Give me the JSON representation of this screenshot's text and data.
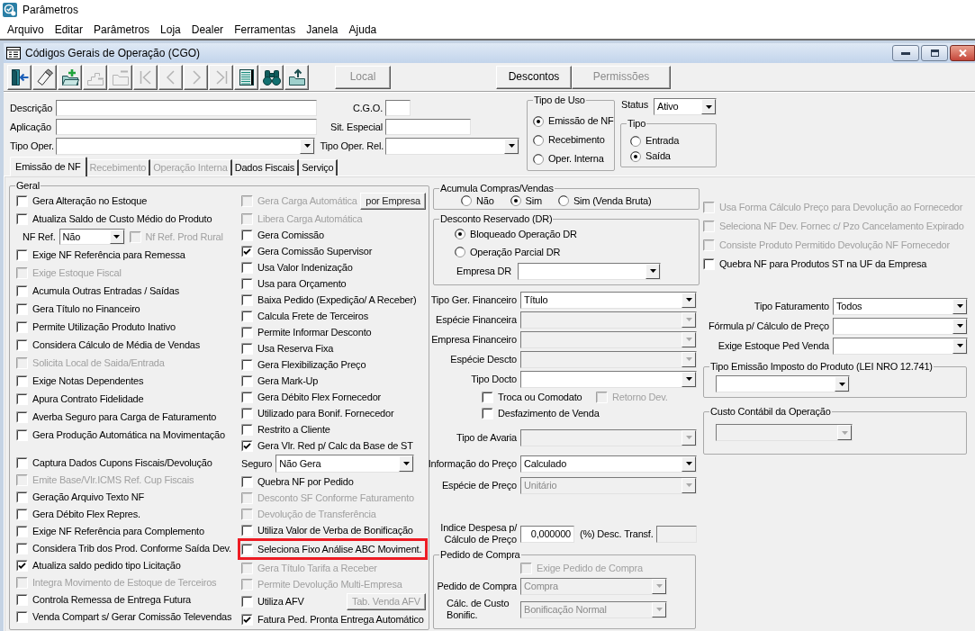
{
  "app": {
    "title": "Parâmetros"
  },
  "menu": [
    "Arquivo",
    "Editar",
    "Parâmetros",
    "Loja",
    "Dealer",
    "Ferramentas",
    "Janela",
    "Ajuda"
  ],
  "window": {
    "title": "Códigos Gerais de Operação (CGO)"
  },
  "toolbar": {
    "icon_buttons": [
      {
        "kind": "exit",
        "disabled": false
      },
      {
        "kind": "erase",
        "disabled": false
      },
      {
        "kind": "add",
        "disabled": false
      },
      {
        "kind": "copy",
        "disabled": true
      },
      {
        "kind": "remove",
        "disabled": true
      },
      {
        "kind": "first",
        "disabled": true
      },
      {
        "kind": "previous",
        "disabled": true
      },
      {
        "kind": "next",
        "disabled": true
      },
      {
        "kind": "last",
        "disabled": true
      },
      {
        "kind": "grid",
        "disabled": false
      },
      {
        "kind": "search",
        "disabled": false
      },
      {
        "kind": "export",
        "disabled": false
      }
    ],
    "text_buttons": [
      {
        "label": "Local",
        "disabled": true
      },
      {
        "label": "Descontos",
        "disabled": false
      },
      {
        "label": "Permissões",
        "disabled": true
      }
    ]
  },
  "header": {
    "description": {
      "label": "Descrição"
    },
    "cgo": {
      "label": "C.G.O."
    },
    "application": {
      "label": "Aplicação"
    },
    "special_situation": {
      "label": "Sit. Especial"
    },
    "operation_type": {
      "label": "Tipo Oper."
    },
    "related_operation_type": {
      "label": "Tipo Oper. Rel."
    },
    "usage_type": {
      "title": "Tipo de Uso",
      "options": [
        {
          "label": "Emissão de NF",
          "selected": true
        },
        {
          "label": "Recebimento",
          "selected": false
        },
        {
          "label": "Oper. Interna",
          "selected": false
        }
      ]
    },
    "status": {
      "label": "Status",
      "value": "Ativo"
    },
    "type": {
      "title": "Tipo",
      "options": [
        {
          "label": "Entrada",
          "selected": false
        },
        {
          "label": "Saída",
          "selected": true
        }
      ]
    }
  },
  "tabs": [
    {
      "label": "Emissão de NF",
      "selected": true,
      "disabled": false
    },
    {
      "label": "Recebimento",
      "selected": false,
      "disabled": true
    },
    {
      "label": "Operação Interna",
      "selected": false,
      "disabled": true
    },
    {
      "label": "Dados Fiscais",
      "selected": false,
      "disabled": false
    },
    {
      "label": "Serviço",
      "selected": false,
      "disabled": false
    }
  ],
  "general": {
    "title": "Geral",
    "column_1": [
      {
        "kind": "checkbox",
        "label": "Gera Alteração no Estoque",
        "checked": false,
        "disabled": false
      },
      {
        "kind": "checkbox",
        "label": "Atualiza Saldo de Custo Médio do Produto",
        "checked": false,
        "disabled": false
      },
      {
        "kind": "reference",
        "label": "NF Ref.",
        "value": "Não",
        "option": {
          "label": "Nf Ref. Prod Rural",
          "checked": false,
          "disabled": true
        }
      },
      {
        "kind": "checkbox",
        "label": "Exige NF Referência para Remessa",
        "checked": false,
        "disabled": false
      },
      {
        "kind": "checkbox",
        "label": "Exige Estoque Fiscal",
        "checked": false,
        "disabled": true
      },
      {
        "kind": "checkbox",
        "label": "Acumula Outras Entradas / Saídas",
        "checked": false,
        "disabled": false
      },
      {
        "kind": "checkbox",
        "label": "Gera Título no Financeiro",
        "checked": false,
        "disabled": false
      },
      {
        "kind": "checkbox",
        "label": "Permite Utilização Produto Inativo",
        "checked": false,
        "disabled": false
      },
      {
        "kind": "checkbox",
        "label": "Considera Cálculo de Média de Vendas",
        "checked": false,
        "disabled": false
      },
      {
        "kind": "checkbox",
        "label": "Solicita Local de Saida/Entrada",
        "checked": false,
        "disabled": true
      },
      {
        "kind": "checkbox",
        "label": "Exige Notas Dependentes",
        "checked": false,
        "disabled": false
      },
      {
        "kind": "checkbox",
        "label": "Apura Contrato Fidelidade",
        "checked": false,
        "disabled": false
      },
      {
        "kind": "checkbox",
        "label": "Averba Seguro para Carga de Faturamento",
        "checked": false,
        "disabled": false
      },
      {
        "kind": "checkbox",
        "label": "Gera Produção Automática na Movimentação",
        "checked": false,
        "disabled": false
      },
      {
        "kind": "checkbox",
        "label": "Captura Dados Cupons Fiscais/Devolução",
        "checked": false,
        "disabled": false
      },
      {
        "kind": "checkbox",
        "label": "Emite Base/Vlr.ICMS Ref. Cup Fiscais",
        "checked": false,
        "disabled": true
      },
      {
        "kind": "checkbox",
        "label": "Geração Arquivo Texto NF",
        "checked": false,
        "disabled": false
      },
      {
        "kind": "checkbox",
        "label": "Gera Débito Flex Repres.",
        "checked": false,
        "disabled": false
      },
      {
        "kind": "checkbox",
        "label": "Exige NF Referência para Complemento",
        "checked": false,
        "disabled": false
      },
      {
        "kind": "checkbox",
        "label": "Considera Trib dos Prod. Conforme Saída Dev.",
        "checked": false,
        "disabled": false
      },
      {
        "kind": "checkbox",
        "label": "Atualiza saldo pedido tipo Licitação",
        "checked": true,
        "disabled": false
      },
      {
        "kind": "checkbox",
        "label": "Integra Movimento de Estoque de Terceiros",
        "checked": false,
        "disabled": true
      },
      {
        "kind": "checkbox",
        "label": "Controla Remessa de Entrega Futura",
        "checked": false,
        "disabled": false
      },
      {
        "kind": "checkbox",
        "label": "Venda Compart s/ Gerar Comissão Televendas",
        "checked": false,
        "disabled": false
      }
    ],
    "column_2": [
      {
        "kind": "checkbox",
        "label": "Gera Carga Automática",
        "checked": false,
        "disabled": true,
        "highlighted": false,
        "button": {
          "label": "por Empresa",
          "disabled": false
        }
      },
      {
        "kind": "checkbox",
        "label": "Libera Carga Automática",
        "checked": false,
        "disabled": true,
        "highlighted": false
      },
      {
        "kind": "checkbox",
        "label": "Gera Comissão",
        "checked": false,
        "disabled": false,
        "highlighted": false
      },
      {
        "kind": "checkbox",
        "label": "Gera Comissão Supervisor",
        "checked": true,
        "disabled": false,
        "highlighted": false
      },
      {
        "kind": "checkbox",
        "label": "Usa Valor Indenização",
        "checked": false,
        "disabled": false,
        "highlighted": false
      },
      {
        "kind": "checkbox",
        "label": "Usa para Orçamento",
        "checked": false,
        "disabled": false,
        "highlighted": false
      },
      {
        "kind": "checkbox",
        "label": "Baixa Pedido (Expedição/ A Receber)",
        "checked": false,
        "disabled": false,
        "highlighted": false
      },
      {
        "kind": "checkbox",
        "label": "Calcula Frete de Terceiros",
        "checked": false,
        "disabled": false,
        "highlighted": false
      },
      {
        "kind": "checkbox",
        "label": "Permite Informar Desconto",
        "checked": false,
        "disabled": false,
        "highlighted": false
      },
      {
        "kind": "checkbox",
        "label": "Usa Reserva Fixa",
        "checked": false,
        "disabled": false,
        "highlighted": false
      },
      {
        "kind": "checkbox",
        "label": "Gera Flexibilização Preço",
        "checked": false,
        "disabled": false,
        "highlighted": false
      },
      {
        "kind": "checkbox",
        "label": "Gera Mark-Up",
        "checked": false,
        "disabled": false,
        "highlighted": false
      },
      {
        "kind": "checkbox",
        "label": "Gera Débito Flex Fornecedor",
        "checked": false,
        "disabled": false,
        "highlighted": false
      },
      {
        "kind": "checkbox",
        "label": "Utilizado para Bonif. Fornecedor",
        "checked": false,
        "disabled": false,
        "highlighted": false
      },
      {
        "kind": "checkbox",
        "label": "Restrito a Cliente",
        "checked": false,
        "disabled": false,
        "highlighted": false
      },
      {
        "kind": "checkbox",
        "label": "Gera Vlr. Red p/ Calc da Base de ST",
        "checked": true,
        "disabled": false,
        "highlighted": false
      },
      {
        "kind": "select",
        "label": "Seguro",
        "value": "Não Gera",
        "disabled": false,
        "highlighted": false
      },
      {
        "kind": "checkbox",
        "label": "Quebra NF por Pedido",
        "checked": false,
        "disabled": false,
        "highlighted": false
      },
      {
        "kind": "checkbox",
        "label": "Desconto SF Conforme Faturamento",
        "checked": false,
        "disabled": true,
        "highlighted": false
      },
      {
        "kind": "checkbox",
        "label": "Devolução de Transferência",
        "checked": false,
        "disabled": true,
        "highlighted": false
      },
      {
        "kind": "checkbox",
        "label": "Utiliza Valor de Verba de Bonificação",
        "checked": false,
        "disabled": false,
        "highlighted": false
      },
      {
        "kind": "checkbox",
        "label": "Seleciona Fixo Análise ABC Moviment.",
        "checked": false,
        "disabled": false,
        "highlighted": true
      },
      {
        "kind": "checkbox",
        "label": "Gera Título Tarifa a Receber",
        "checked": false,
        "disabled": true,
        "highlighted": false
      },
      {
        "kind": "checkbox",
        "label": "Permite Devolução Multi-Empresa",
        "checked": false,
        "disabled": true,
        "highlighted": false
      },
      {
        "kind": "checkbox",
        "label": "Utiliza AFV",
        "checked": false,
        "disabled": false,
        "highlighted": false,
        "button": {
          "label": "Tab. Venda AFV",
          "disabled": true
        }
      },
      {
        "kind": "checkbox",
        "label": "Fatura Ped. Pronta Entrega Automático",
        "checked": true,
        "disabled": false,
        "highlighted": false
      }
    ]
  },
  "purchases_sales": {
    "title": "Acumula Compras/Vendas",
    "options": [
      {
        "label": "Não",
        "selected": false
      },
      {
        "label": "Sim",
        "selected": true
      },
      {
        "label": "Sim (Venda Bruta)",
        "selected": false
      }
    ]
  },
  "reserved_discount": {
    "title": "Desconto Reservado (DR)",
    "options": [
      {
        "label": "Bloqueado Operação DR",
        "selected": true
      },
      {
        "label": "Operação Parcial DR",
        "selected": false
      }
    ],
    "company": {
      "label": "Empresa DR",
      "disabled": false
    }
  },
  "financial_fields": [
    {
      "kind": "select",
      "label": "Tipo Ger. Financeiro",
      "value": "Título",
      "disabled": false
    },
    {
      "kind": "select",
      "label": "Espécie Financeira",
      "disabled": true
    },
    {
      "kind": "select",
      "label": "Empresa Financeiro",
      "disabled": true
    },
    {
      "kind": "select",
      "label": "Espécie Descto",
      "disabled": true
    },
    {
      "kind": "select",
      "label": "Tipo Docto",
      "disabled": false
    },
    {
      "kind": "checkboxes",
      "items": [
        {
          "label": "Troca ou Comodato",
          "checked": false,
          "disabled": false
        },
        {
          "label": "Retorno Dev.",
          "checked": false,
          "disabled": true
        }
      ]
    },
    {
      "kind": "checkboxes",
      "items": [
        {
          "label": "Desfazimento de Venda",
          "checked": false,
          "disabled": false
        }
      ]
    },
    {
      "kind": "select",
      "label": "Tipo de Avaria",
      "disabled": true
    },
    {
      "kind": "select",
      "label": "Informação do Preço",
      "value": "Calculado",
      "disabled": false
    },
    {
      "kind": "select",
      "label": "Espécie de Preço",
      "value": "Unitário",
      "disabled": true
    }
  ],
  "expense_index": {
    "label": "Indice Despesa p/ Cálculo de Preço",
    "value": "0,000000"
  },
  "transfer_discount": {
    "label": "(%) Desc. Transf.",
    "disabled": true
  },
  "purchase_order": {
    "title": "Pedido de Compra",
    "requirement": {
      "label": "Exige Pedido de Compra",
      "checked": false,
      "disabled": true
    },
    "fields": [
      {
        "label": "Pedido de Compra",
        "value": "Compra",
        "disabled": true
      },
      {
        "label": "Cálc. de Custo Bonific.",
        "value": "Bonificação Normal",
        "disabled": true
      }
    ]
  },
  "supplier_returns": [
    {
      "label": "Usa Forma Cálculo Preço para Devolução ao Fornecedor",
      "checked": false,
      "disabled": true
    },
    {
      "label": "Seleciona NF Dev. Fornec c/ Pzo Cancelamento Expirado",
      "checked": false,
      "disabled": true
    },
    {
      "label": "Consiste Produto Permitido Devolução NF Fornecedor",
      "checked": false,
      "disabled": true
    },
    {
      "label": "Quebra NF para Produtos ST na UF da Empresa",
      "checked": false,
      "disabled": false
    }
  ],
  "billing_fields": [
    {
      "label": "Tipo Faturamento",
      "value": "Todos",
      "disabled": false
    },
    {
      "label": "Fórmula p/ Cálculo de Preço",
      "disabled": false
    },
    {
      "label": "Exige Estoque Ped Venda",
      "disabled": false
    }
  ],
  "tax_emission": {
    "title": "Tipo Emissão Imposto do Produto (LEI NRO 12.741)",
    "disabled": false
  },
  "accounting_cost": {
    "title": "Custo Contábil da Operação",
    "disabled": true
  }
}
